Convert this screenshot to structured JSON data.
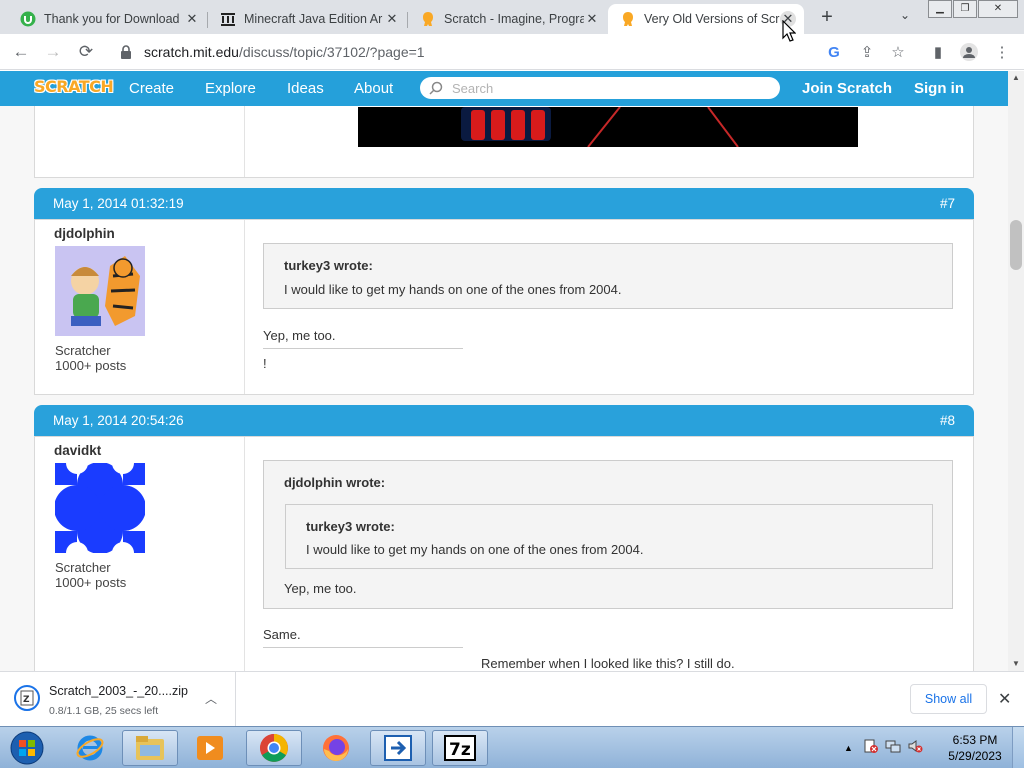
{
  "browser": {
    "tabs": [
      {
        "title": "Thank you for Download",
        "icon": "uptodown-icon",
        "active": false
      },
      {
        "title": "Minecraft Java Edition Ar",
        "icon": "archive-org-icon",
        "active": false
      },
      {
        "title": "Scratch - Imagine, Progra",
        "icon": "scratch-cat-icon",
        "active": false
      },
      {
        "title": "Very Old Versions of Scra",
        "icon": "scratch-cat-icon",
        "active": true
      }
    ],
    "url_domain": "scratch.mit.edu",
    "url_path": "/discuss/topic/37102/?page=1"
  },
  "scratch_nav": {
    "logo": "SCRATCH",
    "links": [
      "Create",
      "Explore",
      "Ideas",
      "About"
    ],
    "search_placeholder": "Search",
    "join": "Join Scratch",
    "signin": "Sign in"
  },
  "posts": [
    {
      "date": "May 1, 2014 01:32:19",
      "number": "#7",
      "author": "djdolphin",
      "rank": "Scratcher",
      "post_count": "1000+ posts",
      "quote_author": "turkey3 wrote:",
      "quote_text": "I would like to get my hands on one of the ones from 2004.",
      "body": "Yep, me too.",
      "signature": "!"
    },
    {
      "date": "May 1, 2014 20:54:26",
      "number": "#8",
      "author": "davidkt",
      "rank": "Scratcher",
      "post_count": "1000+ posts",
      "quote_author": "djdolphin wrote:",
      "nested_quote_author": "turkey3 wrote:",
      "nested_quote_text": "I would like to get my hands on one of the ones from 2004.",
      "quote_text": "Yep, me too.",
      "body": "Same.",
      "signature": "Remember when I looked like this? I still do."
    }
  ],
  "download": {
    "file": "Scratch_2003_-_20....zip",
    "status": "0.8/1.1 GB, 25 secs left",
    "show_all": "Show all"
  },
  "taskbar": {
    "time": "6:53 PM",
    "date": "5/29/2023"
  },
  "colors": {
    "scratch_blue": "#25a0da",
    "post_header": "#29a1db",
    "avatar_blue": "#1a3cff"
  }
}
